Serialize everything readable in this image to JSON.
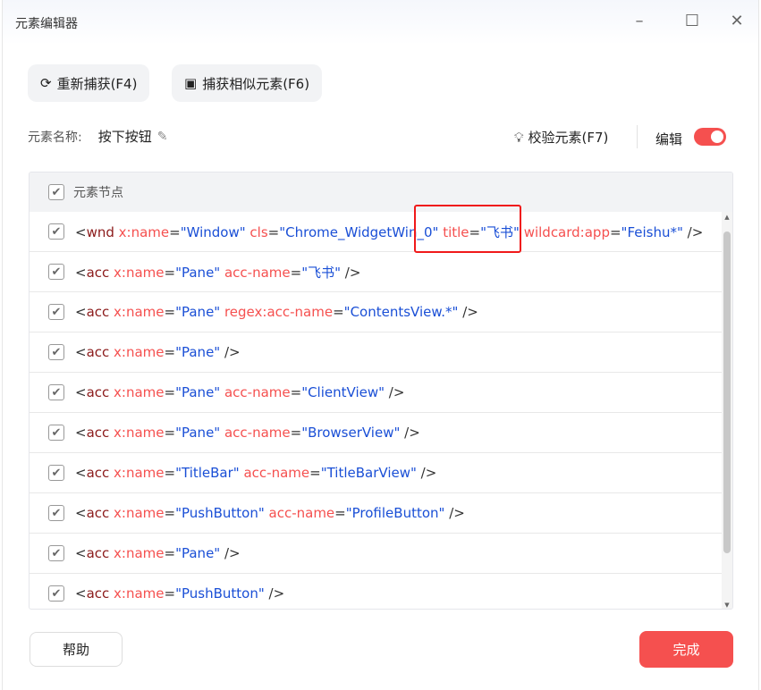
{
  "window": {
    "title": "元素编辑器"
  },
  "toolbar": {
    "recapture": "重新捕获(F4)",
    "capture_similar": "捕获相似元素(F6)"
  },
  "element": {
    "name_label": "元素名称:",
    "name_value": "按下按钮",
    "verify": "校验元素(F7)",
    "edit_label": "编辑",
    "edit_on": true
  },
  "table": {
    "header": "元素节点",
    "rows": [
      [
        {
          "t": "<",
          "c": "pt"
        },
        {
          "t": "wnd",
          "c": "tg"
        },
        {
          "t": " x:name",
          "c": "an"
        },
        {
          "t": "=",
          "c": "pt"
        },
        {
          "t": "\"Window\"",
          "c": "av"
        },
        {
          "t": " cls",
          "c": "an"
        },
        {
          "t": "=",
          "c": "pt"
        },
        {
          "t": "\"Chrome_WidgetWin_0\"",
          "c": "av"
        },
        {
          "t": " title",
          "c": "an"
        },
        {
          "t": "=",
          "c": "pt"
        },
        {
          "t": "\"飞书\"",
          "c": "av"
        },
        {
          "t": " wildcard:app",
          "c": "an"
        },
        {
          "t": "=",
          "c": "pt"
        },
        {
          "t": "\"Feishu*\"",
          "c": "av"
        },
        {
          "t": " />",
          "c": "pt"
        }
      ],
      [
        {
          "t": "<",
          "c": "pt"
        },
        {
          "t": "acc",
          "c": "tg"
        },
        {
          "t": " x:name",
          "c": "an"
        },
        {
          "t": "=",
          "c": "pt"
        },
        {
          "t": "\"Pane\"",
          "c": "av"
        },
        {
          "t": " acc-name",
          "c": "an"
        },
        {
          "t": "=",
          "c": "pt"
        },
        {
          "t": "\"飞书\"",
          "c": "av"
        },
        {
          "t": " />",
          "c": "pt"
        }
      ],
      [
        {
          "t": "<",
          "c": "pt"
        },
        {
          "t": "acc",
          "c": "tg"
        },
        {
          "t": " x:name",
          "c": "an"
        },
        {
          "t": "=",
          "c": "pt"
        },
        {
          "t": "\"Pane\"",
          "c": "av"
        },
        {
          "t": " regex:acc-name",
          "c": "an"
        },
        {
          "t": "=",
          "c": "pt"
        },
        {
          "t": "\"ContentsView.*\"",
          "c": "av"
        },
        {
          "t": " />",
          "c": "pt"
        }
      ],
      [
        {
          "t": "<",
          "c": "pt"
        },
        {
          "t": "acc",
          "c": "tg"
        },
        {
          "t": " x:name",
          "c": "an"
        },
        {
          "t": "=",
          "c": "pt"
        },
        {
          "t": "\"Pane\"",
          "c": "av"
        },
        {
          "t": " />",
          "c": "pt"
        }
      ],
      [
        {
          "t": "<",
          "c": "pt"
        },
        {
          "t": "acc",
          "c": "tg"
        },
        {
          "t": " x:name",
          "c": "an"
        },
        {
          "t": "=",
          "c": "pt"
        },
        {
          "t": "\"Pane\"",
          "c": "av"
        },
        {
          "t": " acc-name",
          "c": "an"
        },
        {
          "t": "=",
          "c": "pt"
        },
        {
          "t": "\"ClientView\"",
          "c": "av"
        },
        {
          "t": " />",
          "c": "pt"
        }
      ],
      [
        {
          "t": "<",
          "c": "pt"
        },
        {
          "t": "acc",
          "c": "tg"
        },
        {
          "t": " x:name",
          "c": "an"
        },
        {
          "t": "=",
          "c": "pt"
        },
        {
          "t": "\"Pane\"",
          "c": "av"
        },
        {
          "t": " acc-name",
          "c": "an"
        },
        {
          "t": "=",
          "c": "pt"
        },
        {
          "t": "\"BrowserView\"",
          "c": "av"
        },
        {
          "t": " />",
          "c": "pt"
        }
      ],
      [
        {
          "t": "<",
          "c": "pt"
        },
        {
          "t": "acc",
          "c": "tg"
        },
        {
          "t": " x:name",
          "c": "an"
        },
        {
          "t": "=",
          "c": "pt"
        },
        {
          "t": "\"TitleBar\"",
          "c": "av"
        },
        {
          "t": " acc-name",
          "c": "an"
        },
        {
          "t": "=",
          "c": "pt"
        },
        {
          "t": "\"TitleBarView\"",
          "c": "av"
        },
        {
          "t": " />",
          "c": "pt"
        }
      ],
      [
        {
          "t": "<",
          "c": "pt"
        },
        {
          "t": "acc",
          "c": "tg"
        },
        {
          "t": " x:name",
          "c": "an"
        },
        {
          "t": "=",
          "c": "pt"
        },
        {
          "t": "\"PushButton\"",
          "c": "av"
        },
        {
          "t": " acc-name",
          "c": "an"
        },
        {
          "t": "=",
          "c": "pt"
        },
        {
          "t": "\"ProfileButton\"",
          "c": "av"
        },
        {
          "t": " />",
          "c": "pt"
        }
      ],
      [
        {
          "t": "<",
          "c": "pt"
        },
        {
          "t": "acc",
          "c": "tg"
        },
        {
          "t": " x:name",
          "c": "an"
        },
        {
          "t": "=",
          "c": "pt"
        },
        {
          "t": "\"Pane\"",
          "c": "av"
        },
        {
          "t": " />",
          "c": "pt"
        }
      ],
      [
        {
          "t": "<",
          "c": "pt"
        },
        {
          "t": "acc",
          "c": "tg"
        },
        {
          "t": " x:name",
          "c": "an"
        },
        {
          "t": "=",
          "c": "pt"
        },
        {
          "t": "\"PushButton\"",
          "c": "av"
        },
        {
          "t": " />",
          "c": "pt"
        }
      ]
    ]
  },
  "footer": {
    "help": "帮助",
    "done": "完成"
  },
  "colors": {
    "accent": "#f5504f",
    "tag": "#8b1a1a",
    "attr": "#f5504f",
    "value": "#1a4fd6"
  }
}
